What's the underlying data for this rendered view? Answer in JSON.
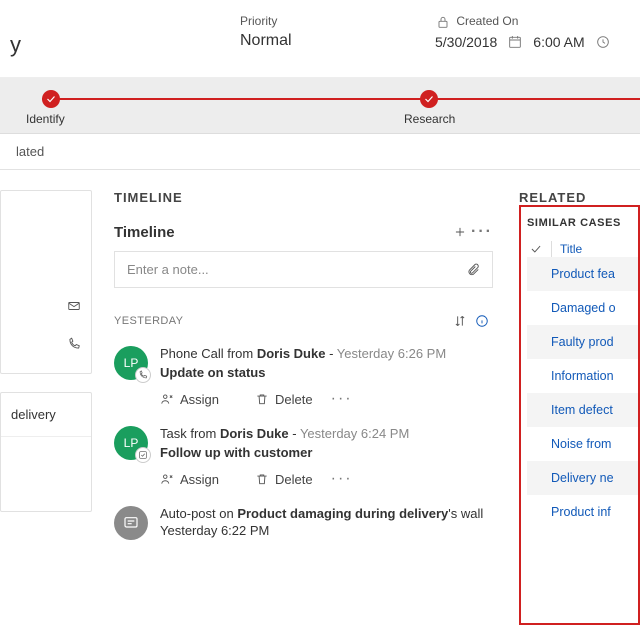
{
  "header": {
    "title": "y",
    "priority_label": "Priority",
    "priority_value": "Normal",
    "created_on_label": "Created On",
    "created_date": "5/30/2018",
    "created_time": "6:00 AM"
  },
  "stages": {
    "identify": "Identify",
    "research": "Research"
  },
  "tabs": {
    "related": "lated"
  },
  "left": {
    "delivery": "delivery"
  },
  "timeline": {
    "title": "TIMELINE",
    "subtitle": "Timeline",
    "note_placeholder": "Enter a note...",
    "section": "YESTERDAY",
    "assign": "Assign",
    "delete": "Delete",
    "items": [
      {
        "prefix": "Phone Call from ",
        "who": "Doris Duke",
        "ts": "Yesterday 6:26 PM",
        "line2": "Update on status"
      },
      {
        "prefix": "Task from ",
        "who": "Doris Duke",
        "ts": "Yesterday 6:24 PM",
        "line2": "Follow up with customer"
      },
      {
        "prefix": "Auto-post on ",
        "who": "Product damaging during delivery",
        "tail": "'s  wall",
        "ts": "Yesterday 6:22 PM",
        "line2": ""
      }
    ]
  },
  "related": {
    "title": "RELATED",
    "section": "SIMILAR CASES",
    "column": "Title",
    "rows": [
      "Product fea",
      "Damaged o",
      "Faulty prod",
      "Information",
      "Item defect",
      "Noise from",
      "Delivery ne",
      "Product inf"
    ]
  }
}
